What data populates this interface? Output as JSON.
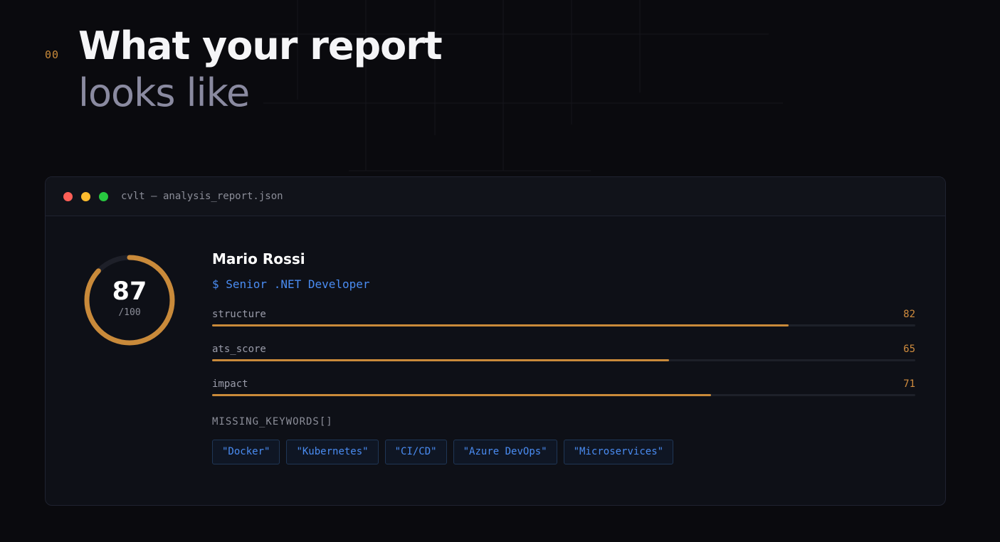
{
  "section": {
    "number": "00"
  },
  "headline": {
    "line1": "What your report",
    "line2": "looks like"
  },
  "window": {
    "title": "cvlt — analysis_report.json",
    "controls": [
      "close",
      "minimize",
      "maximize"
    ]
  },
  "score": {
    "value": "87",
    "max": "/100",
    "fraction": 0.87
  },
  "candidate": {
    "name": "Mario Rossi",
    "role": "$ Senior .NET Developer"
  },
  "metrics": [
    {
      "label": "structure",
      "value": "82",
      "fraction": 0.82
    },
    {
      "label": "ats_score",
      "value": "65",
      "fraction": 0.65
    },
    {
      "label": "impact",
      "value": "71",
      "fraction": 0.71
    }
  ],
  "missing_keywords": {
    "title": "MISSING_KEYWORDS[]",
    "items": [
      "\"Docker\"",
      "\"Kubernetes\"",
      "\"CI/CD\"",
      "\"Azure DevOps\"",
      "\"Microservices\""
    ]
  },
  "colors": {
    "accent": "#c98a3a",
    "link": "#4a8cf2",
    "background": "#0a0a0e",
    "window_bg": "#0e1017"
  }
}
